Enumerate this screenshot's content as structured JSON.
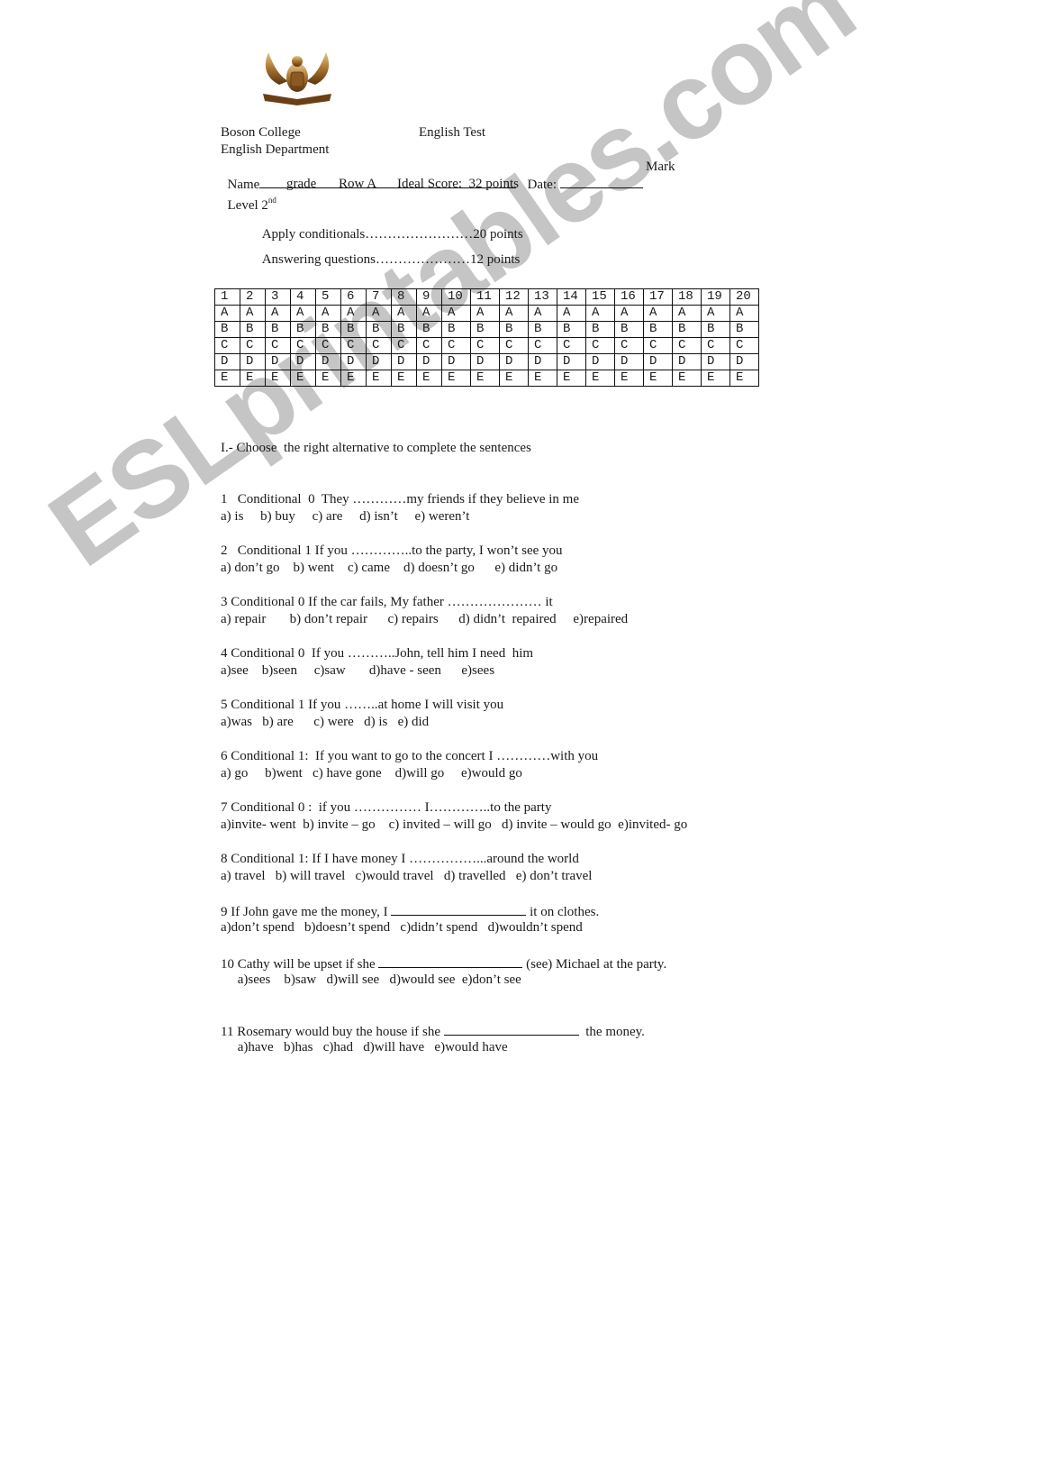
{
  "header": {
    "school": "Boson College",
    "test_title": "English Test",
    "department": "English Department",
    "name_label": "Name",
    "date_label": "Date:",
    "mark_label": "Mark",
    "level_label": "Level 2",
    "level_sup": "nd",
    "grade_label": "grade",
    "row_label": "Row A",
    "ideal_score": "Ideal Score:  32 points"
  },
  "scoring": [
    {
      "label": "Apply conditionals",
      "dots": "……………………",
      "points": "20 points"
    },
    {
      "label": "Answering questions",
      "dots": "…………………",
      "points": "12 points"
    }
  ],
  "answer_grid": {
    "numbers": [
      "1",
      "2",
      "3",
      "4",
      "5",
      "6",
      "7",
      "8",
      "9",
      "10",
      "11",
      "12",
      "13",
      "14",
      "15",
      "16",
      "17",
      "18",
      "19",
      "20"
    ],
    "options": [
      "A",
      "B",
      "C",
      "D",
      "E"
    ]
  },
  "section": {
    "title": "I.- Choose  the right alternative to complete the sentences"
  },
  "questions": [
    {
      "stem": "1   Conditional  0  They …………my friends if they believe in me",
      "options": "a) is     b) buy     c) are     d) isn’t     e) weren’t"
    },
    {
      "stem": "2   Conditional 1 If you …………..to the party, I won’t see you",
      "options": "a) don’t go    b) went    c) came    d) doesn’t go      e) didn’t go"
    },
    {
      "stem": "3 Conditional 0 If the car fails, My father ………………… it",
      "options": "a) repair       b) don’t repair      c) repairs      d) didn’t  repaired     e)repaired"
    },
    {
      "stem": "4 Conditional 0  If you ………..John, tell him I need  him",
      "options": "a)see    b)seen     c)saw       d)have - seen      e)sees"
    },
    {
      "stem": "5 Conditional 1 If you ……..at home I will visit you",
      "options": "a)was   b) are      c) were   d) is   e) did"
    },
    {
      "stem": "6 Conditional 1:  If you want to go to the concert I …………with you",
      "options": "a) go     b)went   c) have gone    d)will go     e)would go"
    },
    {
      "stem": "7 Conditional 0 :  if you …………… I…………..to the party",
      "options": "a)invite- went  b) invite – go    c) invited – will go   d) invite – would go  e)invited- go"
    },
    {
      "stem": "8 Conditional 1: If I have money I ……………...around the world",
      "options": "a) travel   b) will travel   c)would travel   d) travelled   e) don’t travel"
    },
    {
      "stem_before": "9 If John gave me the money, I ",
      "stem_after": " it on clothes.",
      "options": "a)don’t spend   b)doesn’t spend   c)didn’t spend   d)wouldn’t spend"
    },
    {
      "stem_before": "10 Cathy will be upset if she ",
      "stem_after": " (see) Michael at the party.",
      "options": "     a)sees    b)saw   d)will see   d)would see  e)don’t see"
    },
    {
      "stem_before": "11 Rosemary would buy the house if she ",
      "stem_after": "  the money.",
      "options": "     a)have   b)has   c)had   d)will have   e)would have"
    }
  ],
  "watermark": "ESLprintables.com"
}
